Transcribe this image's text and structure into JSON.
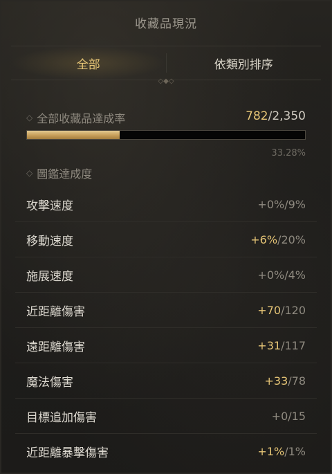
{
  "header": {
    "title": "收藏品現況"
  },
  "tabs": [
    {
      "label": "全部"
    },
    {
      "label": "依類別排序"
    }
  ],
  "overall": {
    "label": "全部收藏品達成率",
    "current": "782",
    "total": "/2,350",
    "progress_fraction": 0.3328,
    "percent": "33.28%"
  },
  "section": {
    "label": "圖鑑達成度"
  },
  "rows": [
    {
      "label": "攻擊速度",
      "gain": "+0%",
      "max": "/9%",
      "highlight": false
    },
    {
      "label": "移動速度",
      "gain": "+6%",
      "max": "/20%",
      "highlight": true
    },
    {
      "label": "施展速度",
      "gain": "+0%",
      "max": "/4%",
      "highlight": false
    },
    {
      "label": "近距離傷害",
      "gain": "+70",
      "max": "/120",
      "highlight": true
    },
    {
      "label": "遠距離傷害",
      "gain": "+31",
      "max": "/117",
      "highlight": true
    },
    {
      "label": "魔法傷害",
      "gain": "+33",
      "max": "/78",
      "highlight": true
    },
    {
      "label": "目標追加傷害",
      "gain": "+0",
      "max": "/15",
      "highlight": false
    },
    {
      "label": "近距離暴擊傷害",
      "gain": "+1%",
      "max": "/1%",
      "highlight": true
    }
  ],
  "colors": {
    "accent_gold": "#e6c576",
    "bar_fill": "#caa25e"
  }
}
